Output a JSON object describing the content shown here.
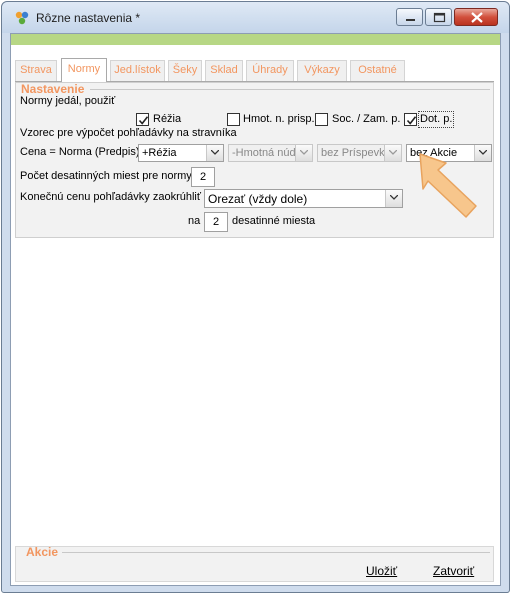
{
  "window": {
    "title": "Rôzne nastavenia *"
  },
  "tabs": [
    "Strava",
    "Normy",
    "Jed.lístok",
    "Šeky",
    "Sklad",
    "Úhrady",
    "Výkazy",
    "Ostatné"
  ],
  "active_tab": "Normy",
  "settings": {
    "legend": "Nastavenie",
    "norms_label": "Normy jedál, použiť",
    "checkboxes": [
      {
        "label": "Réžia",
        "checked": true
      },
      {
        "label": "Hmot. n. prisp.",
        "checked": false
      },
      {
        "label": "Soc. / Zam. p.",
        "checked": false
      },
      {
        "label": "Dot. p.",
        "checked": true
      }
    ],
    "formula_label": "Vzorec pre výpočet pohľadávky na stravníka",
    "price_label": "Cena = Norma (Predpis)",
    "price_combos": [
      "+Réžia",
      "-Hmotná núdz",
      "bez Príspevk",
      "bez Akcie"
    ],
    "decimals_label": "Počet desatinných miest pre normy",
    "decimals_value": "2",
    "rounding_label": "Konečnú cenu pohľadávky zaokrúhliť",
    "rounding_value": "Orezať (vždy dole)",
    "na_label": "na",
    "rounding_decimals": "2",
    "rounding_suffix": "desatinné miesta"
  },
  "actions": {
    "legend": "Akcie",
    "save": "Uložiť",
    "close": "Zatvoriť"
  },
  "colors": {
    "accent": "#f29660",
    "green_bar": "#b7d785",
    "arrow": "#f7c68c"
  }
}
